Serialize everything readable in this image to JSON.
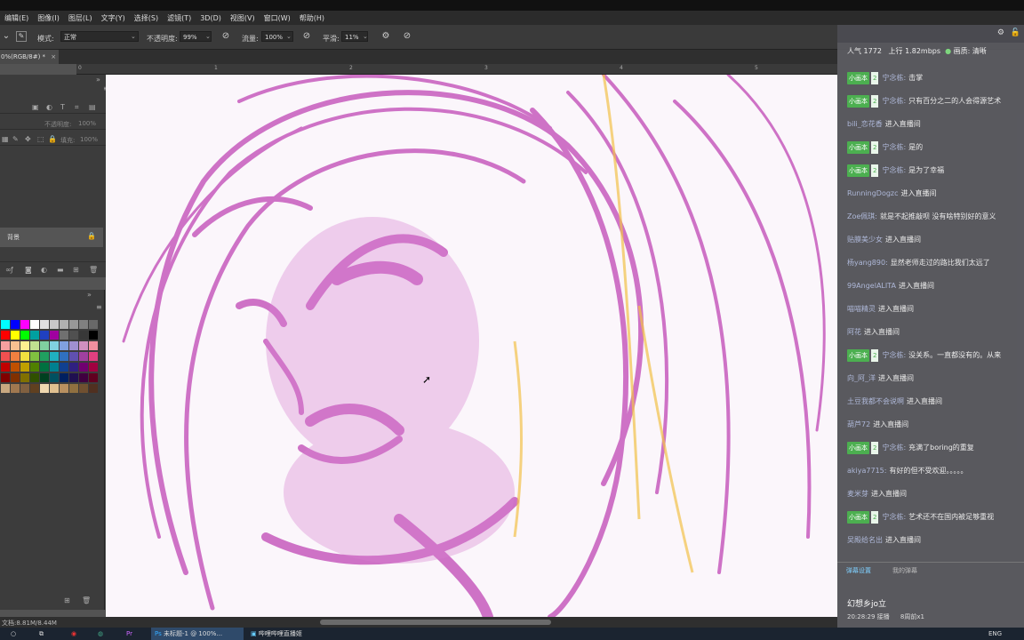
{
  "menubar": {
    "items": [
      "编辑(E)",
      "图像(I)",
      "图层(L)",
      "文字(Y)",
      "选择(S)",
      "滤镜(T)",
      "3D(D)",
      "视图(V)",
      "窗口(W)",
      "帮助(H)"
    ]
  },
  "options": {
    "mode_label": "模式:",
    "mode_value": "正常",
    "opacity_label": "不透明度:",
    "opacity_value": "99%",
    "flow_label": "流量:",
    "flow_value": "100%",
    "smooth_label": "平滑:",
    "smooth_value": "11%"
  },
  "document": {
    "tab_label": "0%(RGB/8#) *",
    "ruler_numbers": [
      "0",
      "1",
      "2",
      "3",
      "4",
      "5"
    ]
  },
  "layers": {
    "opacity_label": "不透明度:",
    "opacity_value": "100%",
    "fill_label": "填充:",
    "fill_value": "100%",
    "background_layer_name": "背景"
  },
  "swatches": {
    "colors": [
      "#00ffff",
      "#0000ff",
      "#ff00ff",
      "#ffffff",
      "#e0e0e0",
      "#c8c8c8",
      "#b0b0b0",
      "#989898",
      "#808080",
      "#686868",
      "#ff0000",
      "#ffff00",
      "#00ff00",
      "#00a0a0",
      "#2040c0",
      "#a000a0",
      "#707070",
      "#505050",
      "#383838",
      "#000000",
      "#f6a0a0",
      "#f8c090",
      "#fff090",
      "#c0e090",
      "#80d0a0",
      "#80d0e0",
      "#80a0e0",
      "#a090d0",
      "#d090c0",
      "#f090a0",
      "#f05050",
      "#f08040",
      "#f0e040",
      "#80c040",
      "#20a060",
      "#20b0c0",
      "#3070c0",
      "#6050b0",
      "#a040a0",
      "#e04080",
      "#c00000",
      "#c05000",
      "#c0a000",
      "#508000",
      "#007040",
      "#008090",
      "#104090",
      "#302080",
      "#700070",
      "#a00040",
      "#800000",
      "#803000",
      "#807000",
      "#305000",
      "#004020",
      "#005060",
      "#002060",
      "#201050",
      "#400040",
      "#600020",
      "#c8a880",
      "#a07850",
      "#806040",
      "#604020",
      "#f0d8b0",
      "#e0c090",
      "#b89060",
      "#907040",
      "#705030",
      "#503020"
    ]
  },
  "statusbar": {
    "text": "文档:8.81M/8.44M"
  },
  "taskbar": {
    "ps_window": "未标题-1 @ 100%...",
    "live_window": "哔哩哔哩直播姬",
    "lang": "ENG"
  },
  "chat": {
    "popularity_label": "人气",
    "popularity_value": "1772",
    "upload_label": "上行",
    "upload_value": "1.82mbps",
    "quality_label": "画质: 清晰",
    "messages": [
      {
        "badge": "小画本",
        "level": "2",
        "user": "宁念栋:",
        "text": "击掌"
      },
      {
        "badge": "小画本",
        "level": "2",
        "user": "宁念栋:",
        "text": "只有百分之二的人会得源艺术"
      },
      {
        "badge": "",
        "level": "",
        "user": "bili_恋花香",
        "text": "进入直播间"
      },
      {
        "badge": "小画本",
        "level": "2",
        "user": "宁念栋:",
        "text": "是的"
      },
      {
        "badge": "小画本",
        "level": "2",
        "user": "宁念栋:",
        "text": "是为了幸福"
      },
      {
        "badge": "",
        "level": "",
        "user": "RunningDogzc",
        "text": "进入直播间"
      },
      {
        "badge": "",
        "level": "",
        "user": "Zoe佩琪:",
        "text": "就是不起推敲呗 没有啥特别好的意义"
      },
      {
        "badge": "",
        "level": "",
        "user": "贴膜美少女",
        "text": "进入直播间"
      },
      {
        "badge": "",
        "level": "",
        "user": "杨yang890:",
        "text": "显然老师走过的路比我们太远了"
      },
      {
        "badge": "",
        "level": "",
        "user": "99AngelALITA",
        "text": "进入直播间"
      },
      {
        "badge": "",
        "level": "",
        "user": "喵喵精灵",
        "text": "进入直播间"
      },
      {
        "badge": "",
        "level": "",
        "user": "阿花",
        "text": "进入直播间"
      },
      {
        "badge": "小画本",
        "level": "2",
        "user": "宁念栋:",
        "text": "没关系。一直都没有的。从来"
      },
      {
        "badge": "",
        "level": "",
        "user": "向_阿_洋",
        "text": "进入直播间"
      },
      {
        "badge": "",
        "level": "",
        "user": "土豆我都不会说啊",
        "text": "进入直播间"
      },
      {
        "badge": "",
        "level": "",
        "user": "葫芦72",
        "text": "进入直播间"
      },
      {
        "badge": "小画本",
        "level": "2",
        "user": "宁念栋:",
        "text": "充满了boring的重复"
      },
      {
        "badge": "",
        "level": "",
        "user": "akiya7715:",
        "text": "有好的但不受欢迎。。。。。"
      },
      {
        "badge": "",
        "level": "",
        "user": "麦米芽",
        "text": "进入直播间"
      },
      {
        "badge": "小画本",
        "level": "2",
        "user": "宁念栋:",
        "text": "艺术还不在国内被足够重视"
      },
      {
        "badge": "",
        "level": "",
        "user": "吴殿给名出",
        "text": "进入直播间"
      }
    ],
    "tab_1": "弹幕设置",
    "tab_2": "我的弹幕",
    "streamer": "幻想乡jo立",
    "time": "20:28:29 接播",
    "viewer_note": "8周前x1"
  }
}
